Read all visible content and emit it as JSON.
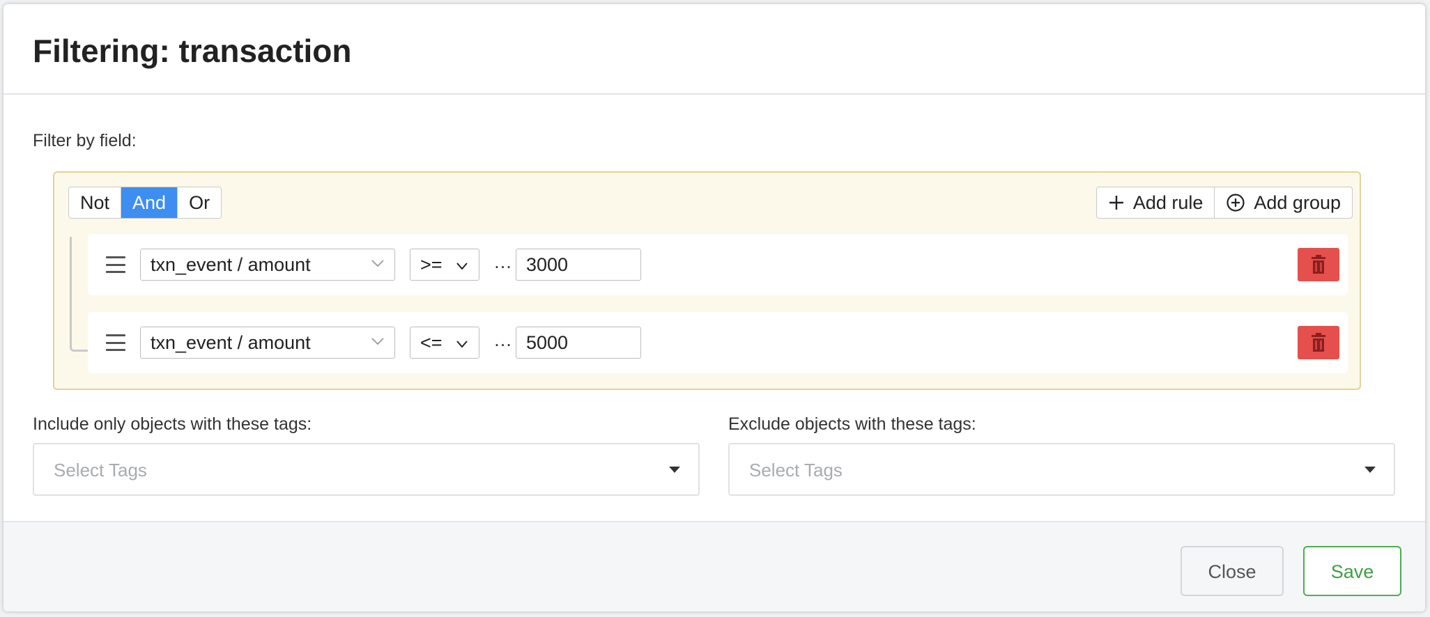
{
  "modal": {
    "title": "Filtering: transaction"
  },
  "filter": {
    "label": "Filter by field:",
    "conjunctions": [
      {
        "label": "Not",
        "active": false
      },
      {
        "label": "And",
        "active": true
      },
      {
        "label": "Or",
        "active": false
      }
    ],
    "add_rule_label": "Add rule",
    "add_group_label": "Add group",
    "rules": [
      {
        "field": "txn_event / amount",
        "operator": ">=",
        "ellipsis": "…",
        "value": "3000"
      },
      {
        "field": "txn_event / amount",
        "operator": "<=",
        "ellipsis": "…",
        "value": "5000"
      }
    ]
  },
  "tags": {
    "include_label": "Include only objects with these tags:",
    "include_placeholder": "Select Tags",
    "exclude_label": "Exclude objects with these tags:",
    "exclude_placeholder": "Select Tags"
  },
  "footer": {
    "close_label": "Close",
    "save_label": "Save"
  },
  "colors": {
    "active_conjunction": "#3d8ef0",
    "delete_button": "#e5504d",
    "save_accent": "#4caf50",
    "group_background": "#fcf9ea"
  },
  "icons": {
    "add_rule": "plus-icon",
    "add_group": "circle-plus-icon",
    "drag": "drag-handle-icon",
    "delete": "trash-icon",
    "dropdown": "chevron-down-icon"
  }
}
